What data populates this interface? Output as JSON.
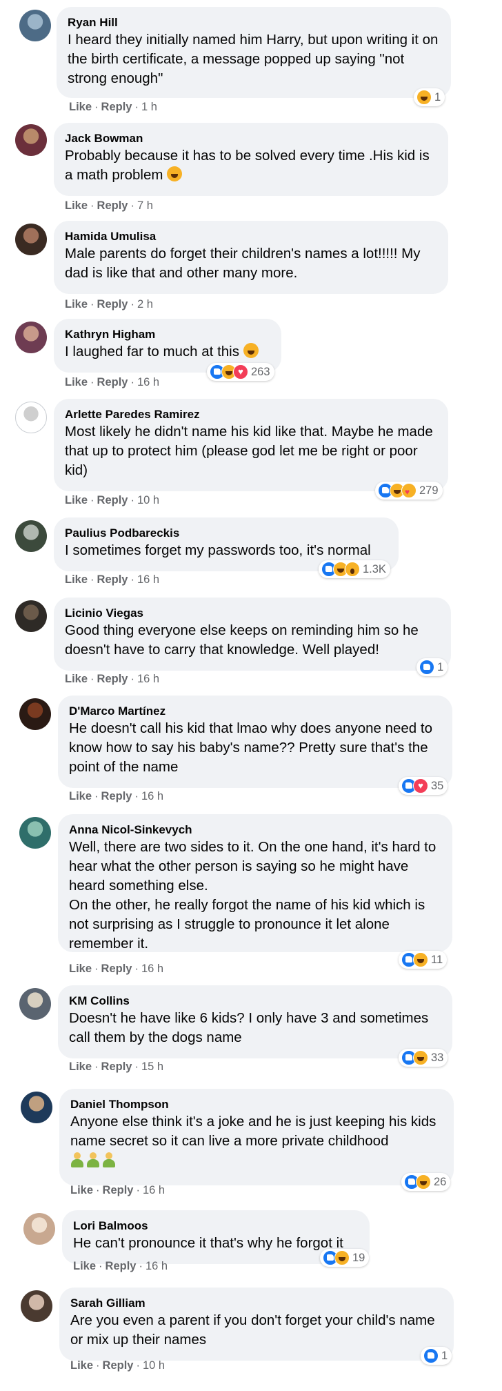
{
  "actions": {
    "like": "Like",
    "reply": "Reply",
    "separator": "·"
  },
  "comments": [
    {
      "author": "Ryan Hill",
      "text": "I heard they initially named him Harry, but upon writing it on the birth certificate, a message popped up saying \"not strong enough\"",
      "time": "1 h",
      "reactions": [
        "haha"
      ],
      "reaction_count": "1",
      "avatar_colors": [
        "#4d6b86",
        "#9bb4c8"
      ]
    },
    {
      "author": "Jack Bowman",
      "text": "Probably because it has to be solved every time .His kid is a math problem",
      "trailing_emoji": "rolling-laughing",
      "time": "7 h",
      "reactions": [],
      "reaction_count": "",
      "avatar_colors": [
        "#6b2f3b",
        "#b88a6a"
      ]
    },
    {
      "author": "Hamida Umulisa",
      "text": "Male parents do forget their children's names a lot!!!!! My dad is like that and other many more.",
      "time": "2 h",
      "reactions": [],
      "reaction_count": "",
      "avatar_colors": [
        "#3a2a22",
        "#a0705a"
      ]
    },
    {
      "author": "Kathryn Higham",
      "text": "I laughed far to much at this",
      "trailing_emoji": "laughing-crying",
      "time": "16 h",
      "reactions": [
        "like",
        "haha",
        "love"
      ],
      "reaction_count": "263",
      "avatar_colors": [
        "#6e3c52",
        "#c89a8a"
      ]
    },
    {
      "author": "Arlette Paredes Ramirez",
      "text": "Most likely he didn't name his kid like that. Maybe he made that up to protect him (please god let me be right or poor kid)",
      "time": "10 h",
      "reactions": [
        "like",
        "haha",
        "care"
      ],
      "reaction_count": "279",
      "avatar_colors": [
        "#ffffff",
        "#cfcfcf"
      ]
    },
    {
      "author": "Paulius Podbareckis",
      "text": "I sometimes forget my passwords too, it's normal",
      "time": "16 h",
      "reactions": [
        "like",
        "haha",
        "wow"
      ],
      "reaction_count": "1.3K",
      "avatar_colors": [
        "#3c4a3c",
        "#b0b8b0"
      ]
    },
    {
      "author": "Licinio Viegas",
      "text": "Good thing everyone else keeps on reminding him so he doesn't have to carry that knowledge. Well played!",
      "time": "16 h",
      "reactions": [
        "like"
      ],
      "reaction_count": "1",
      "avatar_colors": [
        "#2e2a26",
        "#6b5a4a"
      ]
    },
    {
      "author": "D'Marco Martínez",
      "text": "He doesn't call his kid that lmao why does anyone need to know how to say his baby's name?? Pretty sure that's the point of the name",
      "time": "16 h",
      "reactions": [
        "like",
        "love"
      ],
      "reaction_count": "35",
      "avatar_colors": [
        "#2a1a14",
        "#7a3a20"
      ]
    },
    {
      "author": "Anna Nicol-Sinkevych",
      "text": "Well, there are two sides to it. On the one hand, it's hard to hear what the other person is saying so he might have heard something else.\nOn the other, he really forgot the name of his kid which is not surprising as I struggle to pronounce it let alone remember it.",
      "time": "16 h",
      "reactions": [
        "like",
        "haha"
      ],
      "reaction_count": "11",
      "avatar_colors": [
        "#2f6e6a",
        "#8ac0b0"
      ]
    },
    {
      "author": "KM Collins",
      "text": "Doesn't he have like 6 kids? I only have 3 and sometimes call them by the dogs name",
      "time": "15 h",
      "reactions": [
        "like",
        "haha"
      ],
      "reaction_count": "33",
      "avatar_colors": [
        "#5a6470",
        "#d8d0c0"
      ]
    },
    {
      "author": "Daniel Thompson",
      "text": "Anyone else think it's a joke and he is just keeping his kids name secret so it can live a more private childhood",
      "trailing_emoji": "three-person-gesturing",
      "time": "16 h",
      "reactions": [
        "like",
        "haha"
      ],
      "reaction_count": "26",
      "avatar_colors": [
        "#1e3a5a",
        "#c0a080"
      ]
    },
    {
      "author": "Lori Balmoos",
      "text": "He can't pronounce it that's why he forgot it",
      "time": "16 h",
      "reactions": [
        "like",
        "haha"
      ],
      "reaction_count": "19",
      "avatar_colors": [
        "#c8a890",
        "#f0e0d0"
      ]
    },
    {
      "author": "Sarah Gilliam",
      "text": "Are you even a parent if you don't forget your child's name or mix up their names",
      "time": "10 h",
      "reactions": [
        "like"
      ],
      "reaction_count": "1",
      "avatar_colors": [
        "#4a3a30",
        "#d0b8a8"
      ]
    }
  ]
}
